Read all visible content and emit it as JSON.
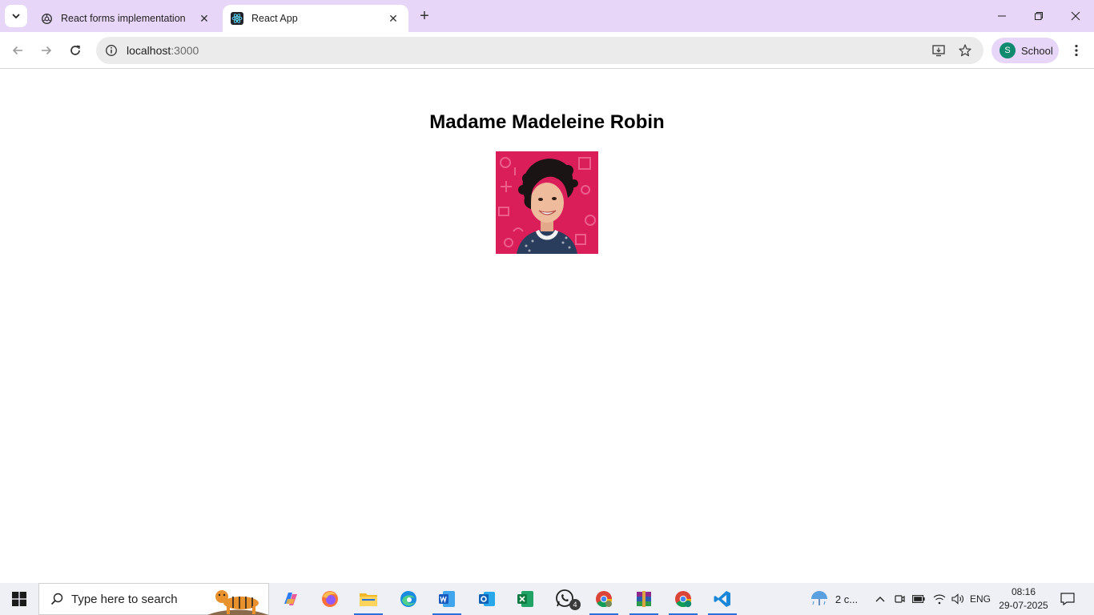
{
  "browser": {
    "tabs": [
      {
        "label": "React forms implementation",
        "active": false
      },
      {
        "label": "React App",
        "active": true
      }
    ],
    "url_host": "localhost",
    "url_port": ":3000",
    "profile": {
      "initial": "S",
      "name": "School"
    }
  },
  "page": {
    "heading": "Madame Madeleine Robin"
  },
  "taskbar": {
    "search_placeholder": "Type here to search",
    "whatsapp_badge": "4",
    "weather": "2 c...",
    "language": "ENG",
    "time": "08:16",
    "date": "29-07-2025"
  },
  "colors": {
    "tabstrip_bg": "#e8d6f8",
    "omnibox_bg": "#ebebeb",
    "portrait_bg": "#d91e5a",
    "accent": "#2a6fdb"
  },
  "icons": [
    "tab-search-icon",
    "chatgpt-icon",
    "react-icon",
    "close-icon",
    "plus-icon",
    "minimize-icon",
    "restore-icon",
    "back-arrow-icon",
    "forward-arrow-icon",
    "reload-icon",
    "info-icon",
    "install-app-icon",
    "bookmark-star-icon",
    "kebab-menu-icon",
    "windows-logo-icon",
    "search-icon"
  ]
}
